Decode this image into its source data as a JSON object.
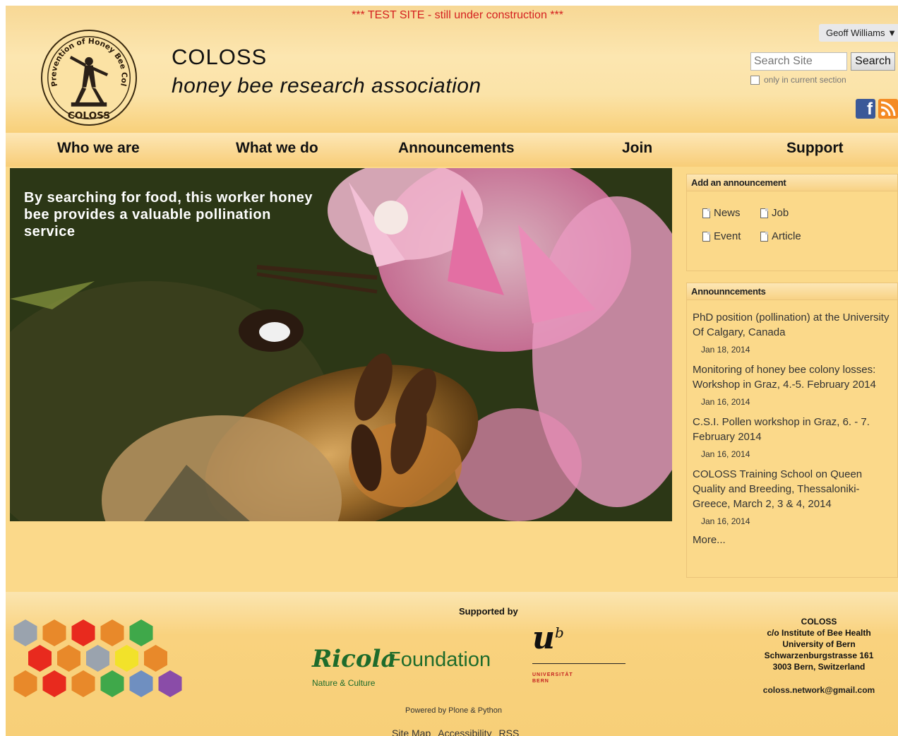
{
  "banner": "*** TEST SITE - still under construction ***",
  "logo": {
    "ring_text": "Prevention of Honey Bee Colony LOSSes",
    "word": "COLOSS"
  },
  "site": {
    "title": "COLOSS",
    "subtitle": "honey bee research association"
  },
  "user_menu": "Geoff Williams ▼",
  "search": {
    "placeholder": "Search Site",
    "button": "Search",
    "only_current": "only in current section"
  },
  "nav": [
    "Who we are",
    "What we do",
    "Announcements",
    "Join",
    "Support"
  ],
  "hero": {
    "caption": "By searching for food, this worker honey bee provides a valuable pollination service"
  },
  "add_announcement": {
    "title": "Add an announcement",
    "items": [
      "News",
      "Job",
      "Event",
      "Article"
    ]
  },
  "announcements": {
    "title": "Announncements",
    "items": [
      {
        "title": "PhD position (pollination) at the University Of Calgary, Canada",
        "date": "Jan 18, 2014"
      },
      {
        "title": "Monitoring of honey bee colony losses: Workshop in Graz, 4.-5. February 2014",
        "date": "Jan 16, 2014"
      },
      {
        "title": "C.S.I. Pollen workshop in Graz, 6. - 7. February 2014",
        "date": "Jan 16, 2014"
      },
      {
        "title": "COLOSS Training School on Queen Quality and Breeding, Thessaloniki- Greece, March 2, 3 & 4, 2014",
        "date": "Jan 16, 2014"
      }
    ],
    "more": "More..."
  },
  "footer": {
    "supported_by": "Supported by",
    "ricola": "Ricola",
    "foundation": "Foundation",
    "nature_culture": "Nature & Culture",
    "unibern_line1": "UNIVERSITÄT",
    "unibern_line2": "BERN",
    "powered": "Powered by Plone & Python",
    "links": [
      "Site Map",
      "Accessibility",
      "RSS"
    ],
    "address": [
      "COLOSS",
      "c/o Institute of Bee Health",
      "University of Bern",
      "Schwarzenburgstrasse 161",
      "3003 Bern, Switzerland"
    ],
    "email": "coloss.network@gmail.com"
  },
  "colors": {
    "background": "#fbd98a",
    "banner_red": "#d42020",
    "ricola_green": "#1e6b2b",
    "hexagons": [
      "#9aa3ae",
      "#e8892a",
      "#e82a1e",
      "#e8892a",
      "#3fa84a",
      "#e82a1e",
      "#e8892a",
      "#9aa3ae",
      "#f2e22a",
      "#e8892a",
      "#e8892a",
      "#e82a1e",
      "#e8892a",
      "#3fa84a",
      "#6f8fc0",
      "#8a4ca8"
    ]
  }
}
